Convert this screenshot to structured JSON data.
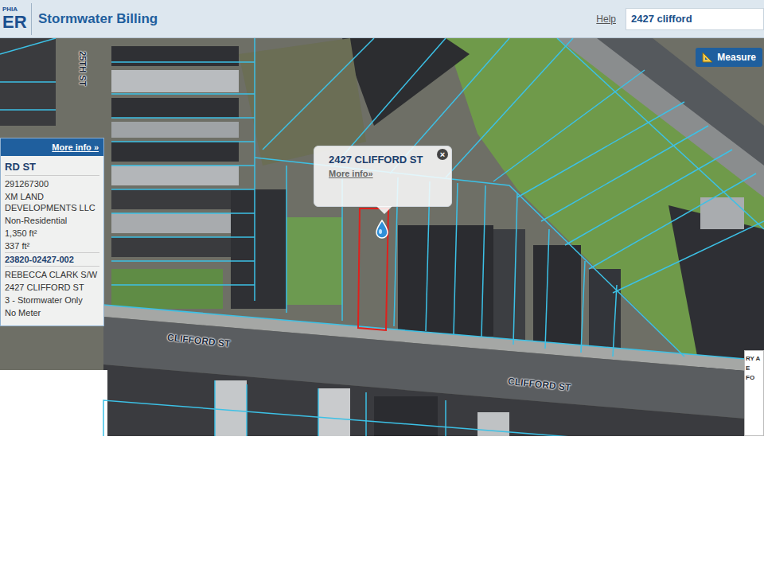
{
  "header": {
    "logo_top": "PHIA",
    "logo_bottom": "ER",
    "title": "Stormwater Billing",
    "help": "Help",
    "search": {
      "value": "2427 clifford"
    }
  },
  "measure_button": {
    "label": "Measure"
  },
  "map": {
    "labels": [
      {
        "text": "25TH ST"
      },
      {
        "text": "CLIFFORD ST"
      },
      {
        "text": "CLIFFORD ST"
      }
    ],
    "corner_panel": [
      "RY A",
      "E",
      "FO"
    ]
  },
  "popup": {
    "title": "2427 CLIFFORD ST",
    "link": "More info»",
    "close": "×"
  },
  "info_panel": {
    "link": "More info »",
    "heading": "RD ST",
    "parcel_rows": [
      "291267300",
      "XM LAND DEVELOPMENTS LLC",
      "Non-Residential",
      "1,350 ft²",
      "337 ft²"
    ],
    "account_heading": "23820-02427-002",
    "account_rows": [
      "REBECCA CLARK S/W",
      "2427 CLIFFORD ST",
      "3 - Stormwater Only",
      "No Meter"
    ]
  }
}
